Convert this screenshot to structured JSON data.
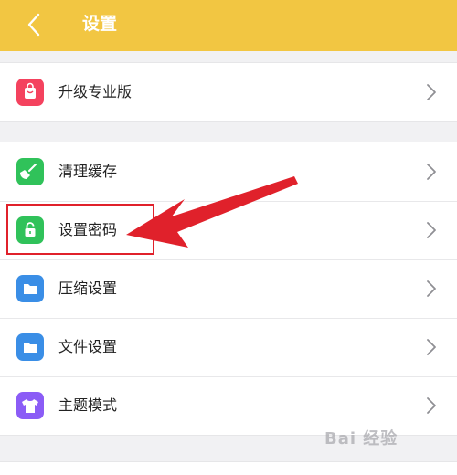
{
  "header": {
    "title": "设置"
  },
  "icons": {
    "back": "chevron-left-icon",
    "chevron": "chevron-right-icon"
  },
  "colors": {
    "header_bg": "#f2c642",
    "upgrade": "#f4425e",
    "clear_cache": "#30c25a",
    "password": "#30c25a",
    "compress": "#3a8ee6",
    "file": "#3a8ee6",
    "theme": "#8b5cf6",
    "annotation": "#e0212b"
  },
  "groups": [
    {
      "items": [
        {
          "label": "升级专业版",
          "icon": "shopping-bag-icon"
        }
      ]
    },
    {
      "items": [
        {
          "label": "清理缓存",
          "icon": "broom-icon"
        },
        {
          "label": "设置密码",
          "icon": "lock-icon"
        },
        {
          "label": "压缩设置",
          "icon": "folder-icon"
        },
        {
          "label": "文件设置",
          "icon": "folder-icon"
        },
        {
          "label": "主题模式",
          "icon": "tshirt-icon"
        }
      ]
    }
  ],
  "watermark": "Bai 经验"
}
